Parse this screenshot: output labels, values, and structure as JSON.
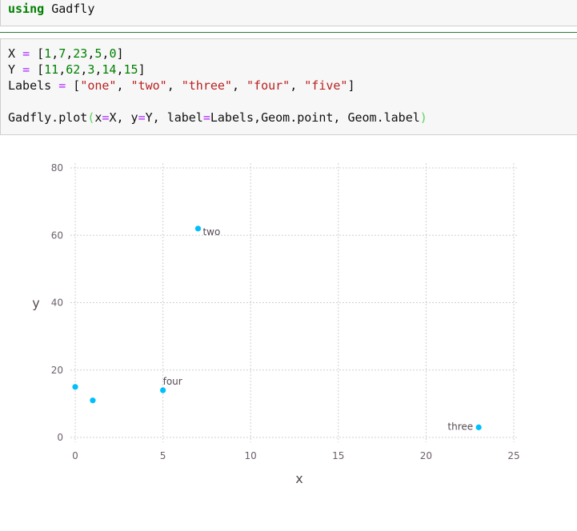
{
  "cell1": {
    "keyword": "using",
    "module": "Gadfly"
  },
  "cell2": {
    "line1": {
      "name": "X",
      "eq": "=",
      "open": "[",
      "nums": [
        "1",
        "7",
        "23",
        "5",
        "0"
      ],
      "close": "]"
    },
    "line2": {
      "name": "Y",
      "eq": "=",
      "open": "[",
      "nums": [
        "11",
        "62",
        "3",
        "14",
        "15"
      ],
      "close": "]"
    },
    "line3": {
      "name": "Labels",
      "eq": "=",
      "open": "[",
      "strs": [
        "\"one\"",
        "\"two\"",
        "\"three\"",
        "\"four\"",
        "\"five\""
      ],
      "close": "]"
    },
    "line4": {
      "fn": "Gadfly.plot",
      "lparen": "(",
      "a1": "x",
      "eq1": "=",
      "v1": "X, ",
      "a2": "y",
      "eq2": "=",
      "v2": "Y, ",
      "a3": "label",
      "eq3": "=",
      "v3": "Labels,Geom.point, Geom.label",
      "rparen": ")"
    }
  },
  "colors": {
    "point": "#00bfff",
    "grid": "#d0d0d0",
    "tick": "#6c606b",
    "axis_label": "#564a55"
  },
  "chart_data": {
    "type": "scatter",
    "xlabel": "x",
    "ylabel": "y",
    "xlim": [
      0,
      25
    ],
    "ylim": [
      0,
      80
    ],
    "xticks": [
      0,
      5,
      10,
      15,
      20,
      25
    ],
    "yticks": [
      0,
      20,
      40,
      60,
      80
    ],
    "grid": true,
    "points": [
      {
        "x": 1,
        "y": 11,
        "label": ""
      },
      {
        "x": 7,
        "y": 62,
        "label": "two"
      },
      {
        "x": 23,
        "y": 3,
        "label": "three"
      },
      {
        "x": 5,
        "y": 14,
        "label": "four"
      },
      {
        "x": 0,
        "y": 15,
        "label": ""
      }
    ]
  }
}
